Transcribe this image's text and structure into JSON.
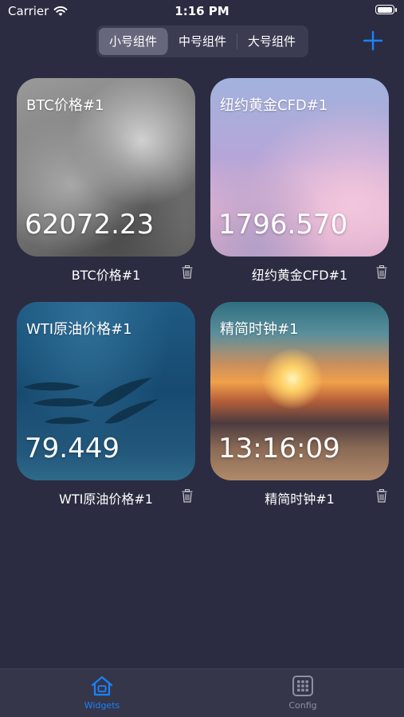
{
  "status_bar": {
    "carrier": "Carrier",
    "time": "1:16 PM",
    "battery_level": 1.0
  },
  "segments": [
    {
      "label": "小号组件",
      "selected": true
    },
    {
      "label": "中号组件",
      "selected": false
    },
    {
      "label": "大号组件",
      "selected": false
    }
  ],
  "add_icon": "plus-icon",
  "widgets": [
    {
      "title": "BTC价格#1",
      "value": "62072.23",
      "label": "BTC价格#1",
      "background": "clouds"
    },
    {
      "title": "纽约黄金CFD#1",
      "value": "1796.570",
      "label": "纽约黄金CFD#1",
      "background": "pink-sky"
    },
    {
      "title": "WTI原油价格#1",
      "value": "79.449",
      "label": "WTI原油价格#1",
      "background": "ocean-dolphins"
    },
    {
      "title": "精简时钟#1",
      "value": "13:16:09",
      "label": "精简时钟#1",
      "background": "sunset-beach"
    }
  ],
  "tabs": [
    {
      "label": "Widgets",
      "icon": "house-icon",
      "active": true
    },
    {
      "label": "Config",
      "icon": "grid-icon",
      "active": false
    }
  ],
  "colors": {
    "accent": "#1a82ff",
    "background": "#2b2c41",
    "tab_inactive": "#8e8f9f"
  }
}
